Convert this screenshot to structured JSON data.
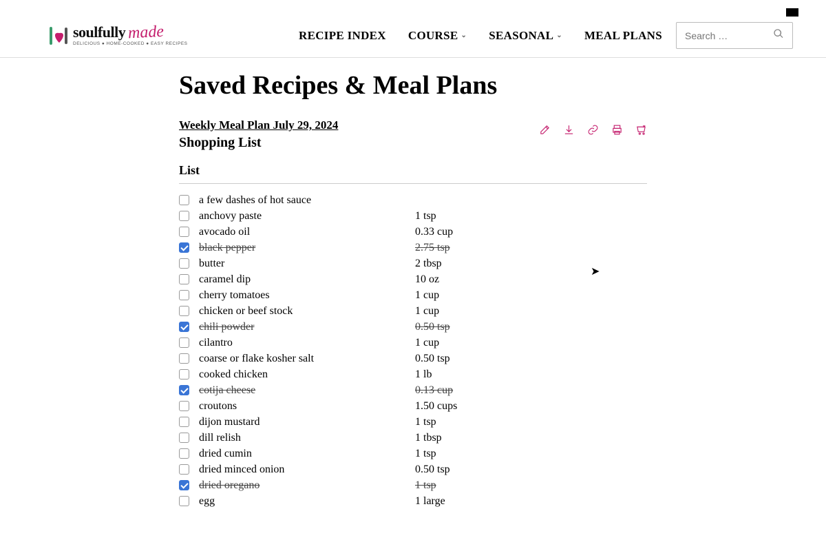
{
  "logo": {
    "soulfully": "soulfully",
    "made": "made",
    "tagline": "DELICIOUS ● HOME-COOKED ● EASY RECIPES"
  },
  "nav": {
    "recipe_index": "RECIPE INDEX",
    "course": "COURSE",
    "seasonal": "SEASONAL",
    "meal_plans": "MEAL PLANS"
  },
  "search": {
    "placeholder": "Search …"
  },
  "page_title": "Saved Recipes & Meal Plans",
  "plan": {
    "title": "Weekly Meal Plan July 29, 2024",
    "subtitle": "Shopping List"
  },
  "list_heading": "List",
  "items": [
    {
      "checked": false,
      "name": "a few dashes of hot sauce",
      "qty": ""
    },
    {
      "checked": false,
      "name": "anchovy paste",
      "qty": "1 tsp"
    },
    {
      "checked": false,
      "name": "avocado oil",
      "qty": "0.33 cup"
    },
    {
      "checked": true,
      "name": "black pepper",
      "qty": "2.75 tsp"
    },
    {
      "checked": false,
      "name": "butter",
      "qty": "2 tbsp"
    },
    {
      "checked": false,
      "name": "caramel dip",
      "qty": "10 oz"
    },
    {
      "checked": false,
      "name": "cherry tomatoes",
      "qty": "1 cup"
    },
    {
      "checked": false,
      "name": "chicken or beef stock",
      "qty": "1 cup"
    },
    {
      "checked": true,
      "name": "chili powder",
      "qty": "0.50 tsp"
    },
    {
      "checked": false,
      "name": "cilantro",
      "qty": "1 cup"
    },
    {
      "checked": false,
      "name": "coarse or flake kosher salt",
      "qty": "0.50 tsp"
    },
    {
      "checked": false,
      "name": "cooked chicken",
      "qty": "1 lb"
    },
    {
      "checked": true,
      "name": "cotija cheese",
      "qty": "0.13 cup"
    },
    {
      "checked": false,
      "name": "croutons",
      "qty": "1.50 cups"
    },
    {
      "checked": false,
      "name": "dijon mustard",
      "qty": "1 tsp"
    },
    {
      "checked": false,
      "name": "dill relish",
      "qty": "1 tbsp"
    },
    {
      "checked": false,
      "name": "dried cumin",
      "qty": "1 tsp"
    },
    {
      "checked": false,
      "name": "dried minced onion",
      "qty": "0.50 tsp"
    },
    {
      "checked": true,
      "name": "dried oregano",
      "qty": "1 tsp"
    },
    {
      "checked": false,
      "name": "egg",
      "qty": "1 large"
    }
  ]
}
